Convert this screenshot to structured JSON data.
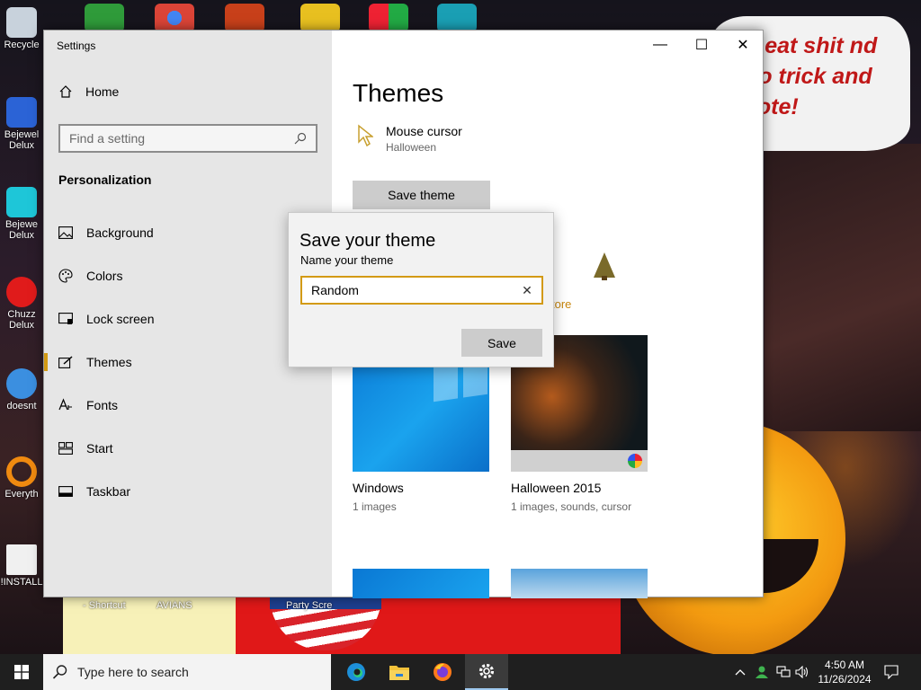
{
  "desktop": {
    "wallpaper_text": "o eat shit nd go trick and vote!",
    "icons": [
      {
        "label": "Recycle"
      },
      {
        "label": "Bejewel Delux"
      },
      {
        "label": "Bejewe Delux"
      },
      {
        "label": "Chuzz Delux"
      },
      {
        "label": "doesnt"
      },
      {
        "label": "Everyth"
      },
      {
        "label": "!INSTALL"
      }
    ],
    "strip_labels": [
      "- Shortcut",
      "AVIANS",
      "Party Scre"
    ]
  },
  "window": {
    "title": "Settings",
    "controls": {
      "minimize": "—",
      "maximize": "☐",
      "close": "✕"
    }
  },
  "nav": {
    "home": "Home",
    "search_placeholder": "Find a setting",
    "section": "Personalization",
    "items": [
      {
        "label": "Background"
      },
      {
        "label": "Colors"
      },
      {
        "label": "Lock screen"
      },
      {
        "label": "Themes"
      },
      {
        "label": "Fonts"
      },
      {
        "label": "Start"
      },
      {
        "label": "Taskbar"
      }
    ]
  },
  "main": {
    "title": "Themes",
    "cursor_label": "Mouse cursor",
    "cursor_value": "Halloween",
    "save_theme": "Save theme",
    "get_more_fragment": "tore",
    "themes": [
      {
        "name": "Windows",
        "desc": "1 images"
      },
      {
        "name": "Halloween 2015",
        "desc": "1 images, sounds, cursor"
      }
    ]
  },
  "dialog": {
    "title": "Save your theme",
    "label": "Name your theme",
    "value": "Random",
    "clear": "✕",
    "save": "Save"
  },
  "taskbar": {
    "search_placeholder": "Type here to search",
    "time": "4:50 AM",
    "date": "11/26/2024"
  },
  "colors": {
    "accent": "#d39a14",
    "nav_bg": "#e6e6e6",
    "button_bg": "#cccccc",
    "taskbar_bg": "#1f1f1f"
  }
}
